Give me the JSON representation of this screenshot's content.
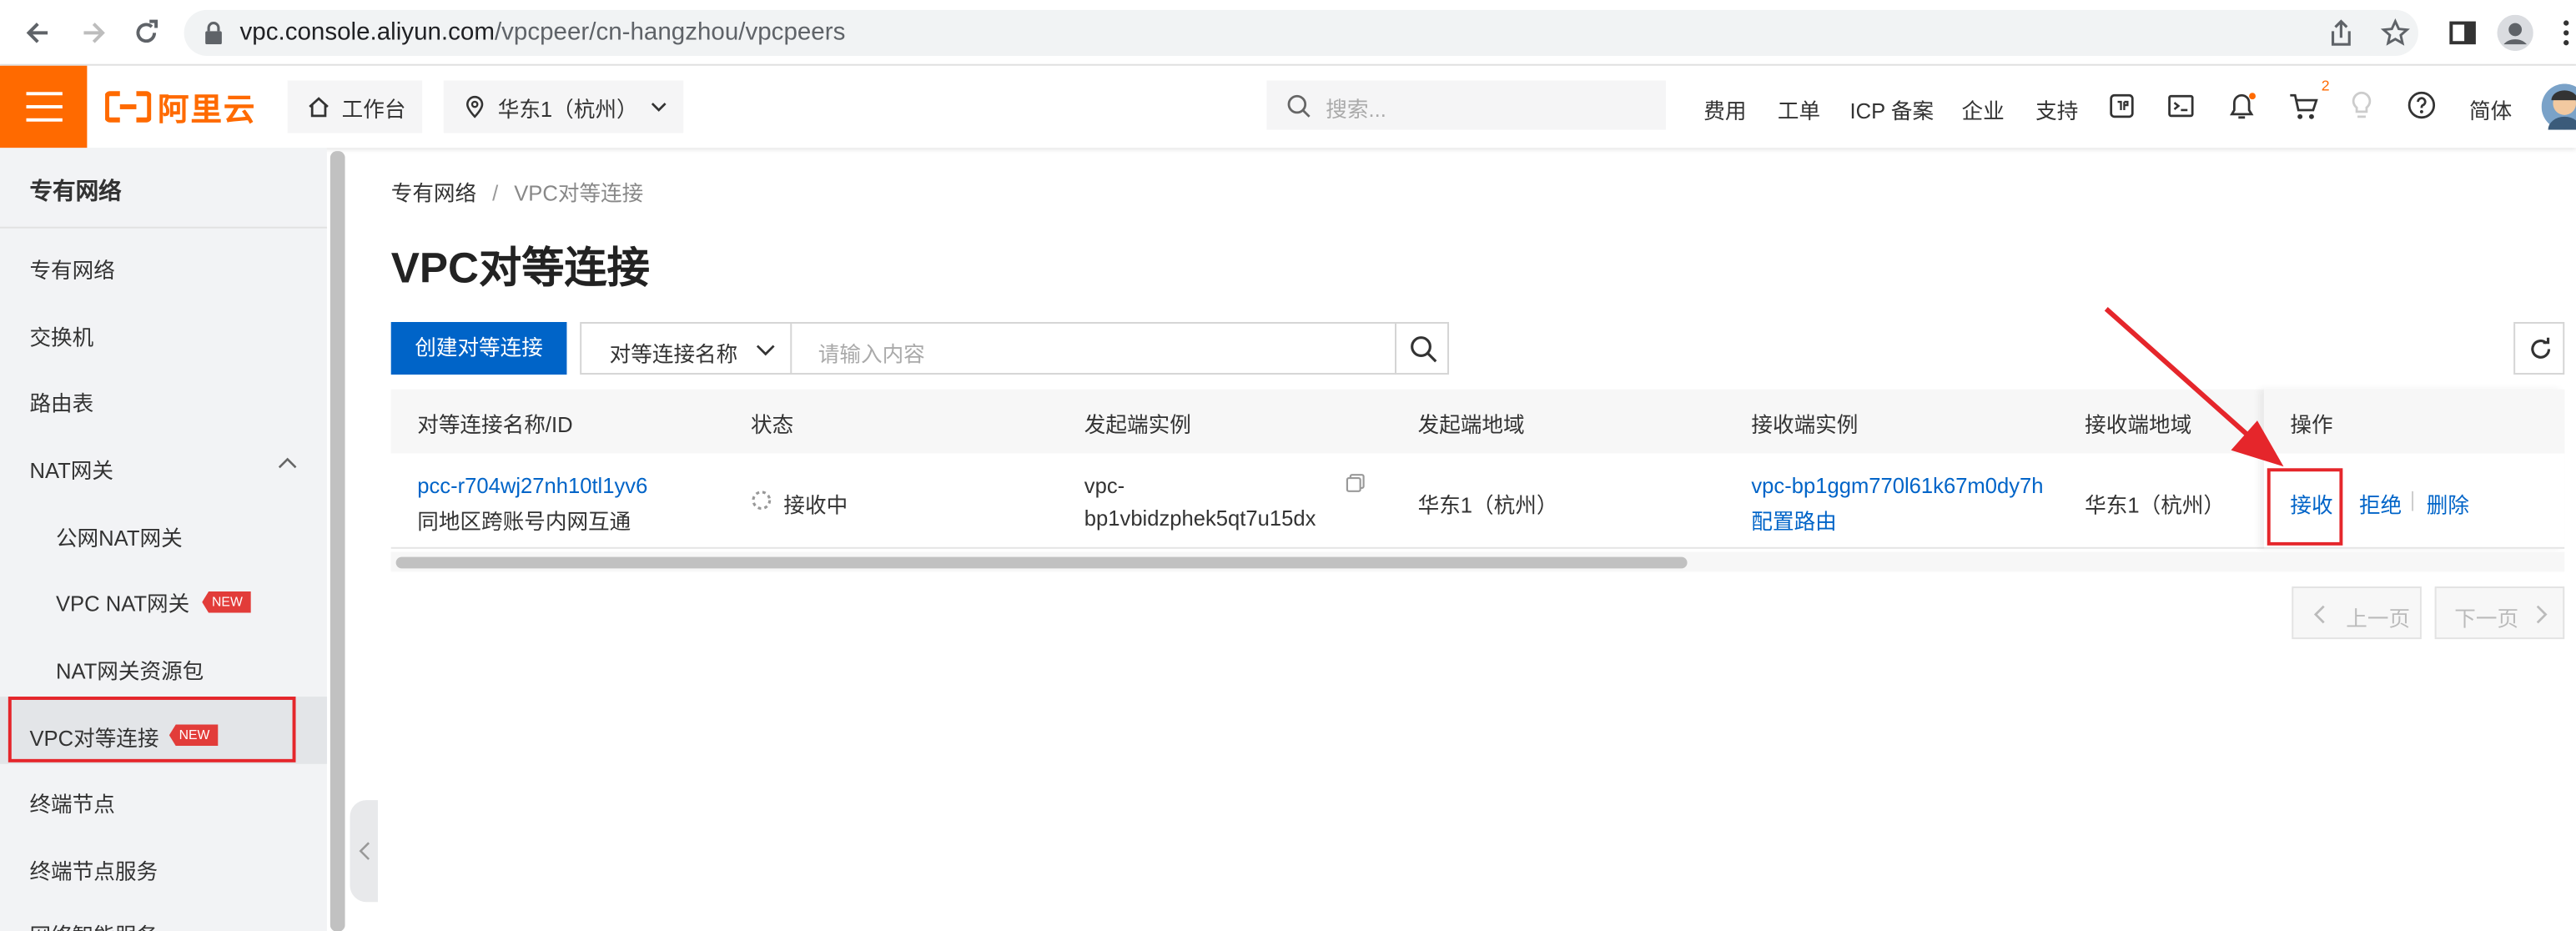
{
  "browser": {
    "url_domain": "vpc.console.aliyun.com",
    "url_path": "/vpcpeer/cn-hangzhou/vpcpeers"
  },
  "header": {
    "logo_text": "阿里云",
    "workbench": "工作台",
    "region": "华东1（杭州）",
    "search_placeholder": "搜索...",
    "nav": [
      "费用",
      "工单",
      "ICP 备案",
      "企业",
      "支持"
    ],
    "cart_badge": "2",
    "language": "简体",
    "accent_color": "#ff6a00"
  },
  "sidebar": {
    "title": "专有网络",
    "items": [
      {
        "label": "专有网络"
      },
      {
        "label": "交换机"
      },
      {
        "label": "路由表"
      },
      {
        "label": "NAT网关"
      },
      {
        "label": "公网NAT网关"
      },
      {
        "label": "VPC NAT网关",
        "badge": "NEW"
      },
      {
        "label": "NAT网关资源包"
      },
      {
        "label": "VPC对等连接",
        "badge": "NEW"
      },
      {
        "label": "终端节点"
      },
      {
        "label": "终端节点服务"
      },
      {
        "label": "网络智能服务"
      }
    ]
  },
  "main": {
    "breadcrumb": [
      "专有网络",
      "VPC对等连接"
    ],
    "breadcrumb_sep": "/",
    "title": "VPC对等连接",
    "create_button": "创建对等连接",
    "filter_select": "对等连接名称",
    "filter_placeholder": "请输入内容",
    "columns": [
      "对等连接名称/ID",
      "状态",
      "发起端实例",
      "发起端地域",
      "接收端实例",
      "接收端地域",
      "操作"
    ],
    "row": {
      "id": "pcc-r704wj27nh10tl1yv6",
      "name": "同地区跨账号内网互通",
      "status": "接收中",
      "initiator_line1": "vpc-",
      "initiator_line2": "bp1vbidzphek5qt7u15dx",
      "initiator_region": "华东1（杭州）",
      "acceptor_instance": "vpc-bp1ggm770l61k67m0dy7h",
      "acceptor_link": "配置路由",
      "acceptor_region": "华东1（杭州）",
      "actions": [
        "接收",
        "拒绝",
        "删除"
      ]
    },
    "pager": {
      "prev": "上一页",
      "next": "下一页"
    },
    "link_color": "#0064c8",
    "primary_color": "#0064c8",
    "highlight_color": "#e5262b"
  }
}
